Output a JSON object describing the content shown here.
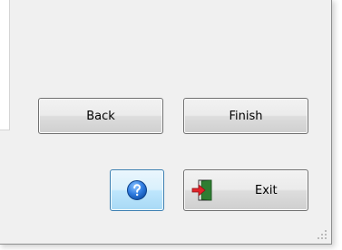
{
  "buttons": {
    "back_label": "Back",
    "finish_label": "Finish",
    "exit_label": "Exit"
  },
  "icons": {
    "help": "help-icon",
    "exit": "exit-door-icon",
    "grip": "resize-grip-icon"
  },
  "colors": {
    "help_accent": "#1f63c6",
    "exit_arrow": "#e2232a",
    "exit_door": "#2f7d32"
  }
}
